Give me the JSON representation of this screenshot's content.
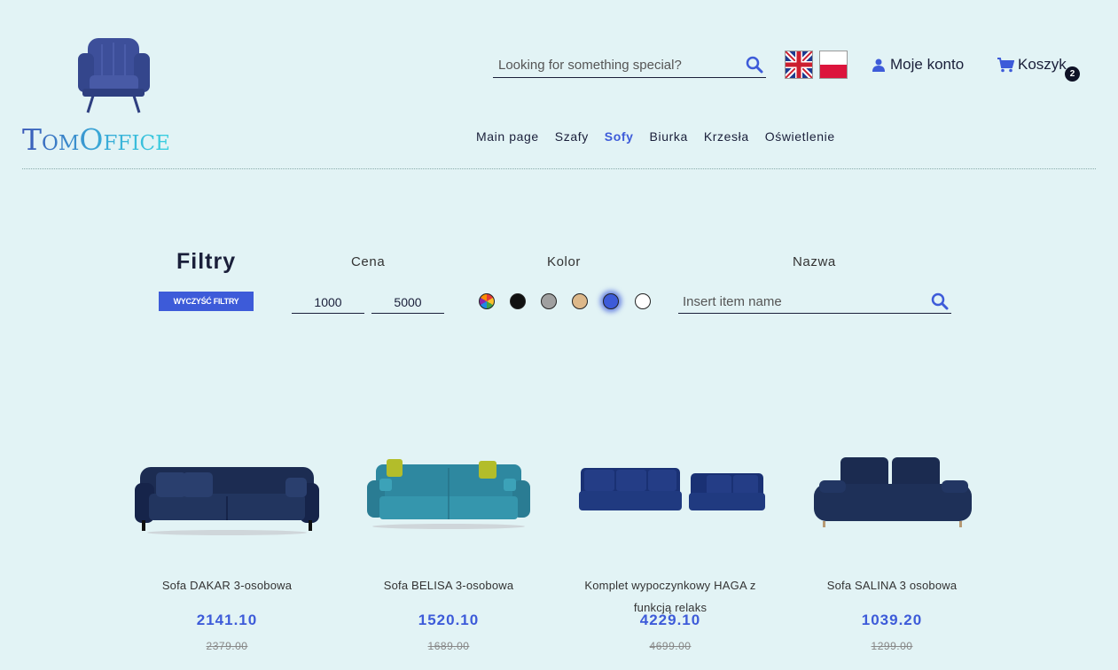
{
  "brand": {
    "name": "TomOffice"
  },
  "header": {
    "search_placeholder": "Looking for something special?",
    "account_label": "Moje konto",
    "cart_label": "Koszyk",
    "cart_count": "2"
  },
  "nav": {
    "items": [
      {
        "label": "Main page",
        "active": false
      },
      {
        "label": "Szafy",
        "active": false
      },
      {
        "label": "Sofy",
        "active": true
      },
      {
        "label": "Biurka",
        "active": false
      },
      {
        "label": "Krzesła",
        "active": false
      },
      {
        "label": "Oświetlenie",
        "active": false
      }
    ]
  },
  "filters": {
    "title": "Filtry",
    "clear_label": "WYCZYŚĆ FILTRY",
    "price_label": "Cena",
    "price_min": "1000",
    "price_max": "5000",
    "color_label": "Kolor",
    "colors": [
      {
        "name": "all-colors",
        "value": "rainbow",
        "selected": false
      },
      {
        "name": "black",
        "value": "#111111",
        "selected": false
      },
      {
        "name": "gray",
        "value": "#a0a0a0",
        "selected": false
      },
      {
        "name": "beige",
        "value": "#ddb88a",
        "selected": false
      },
      {
        "name": "blue",
        "value": "#3d5bd9",
        "selected": true
      },
      {
        "name": "white",
        "value": "#ffffff",
        "selected": false
      }
    ],
    "name_label": "Nazwa",
    "name_placeholder": "Insert item name"
  },
  "products": [
    {
      "name": "Sofa DAKAR 3-osobowa",
      "price": "2141.10",
      "old_price": "2379.00"
    },
    {
      "name": "Sofa BELISA 3-osobowa",
      "price": "1520.10",
      "old_price": "1689.00"
    },
    {
      "name": "Komplet wypoczynkowy HAGA z funkcją relaks",
      "price": "4229.10",
      "old_price": "4699.00"
    },
    {
      "name": "Sofa SALINA 3 osobowa",
      "price": "1039.20",
      "old_price": "1299.00"
    }
  ],
  "colors": {
    "accent": "#3d5bd9",
    "background": "#e2f3f5",
    "text": "#1a1f3a"
  }
}
